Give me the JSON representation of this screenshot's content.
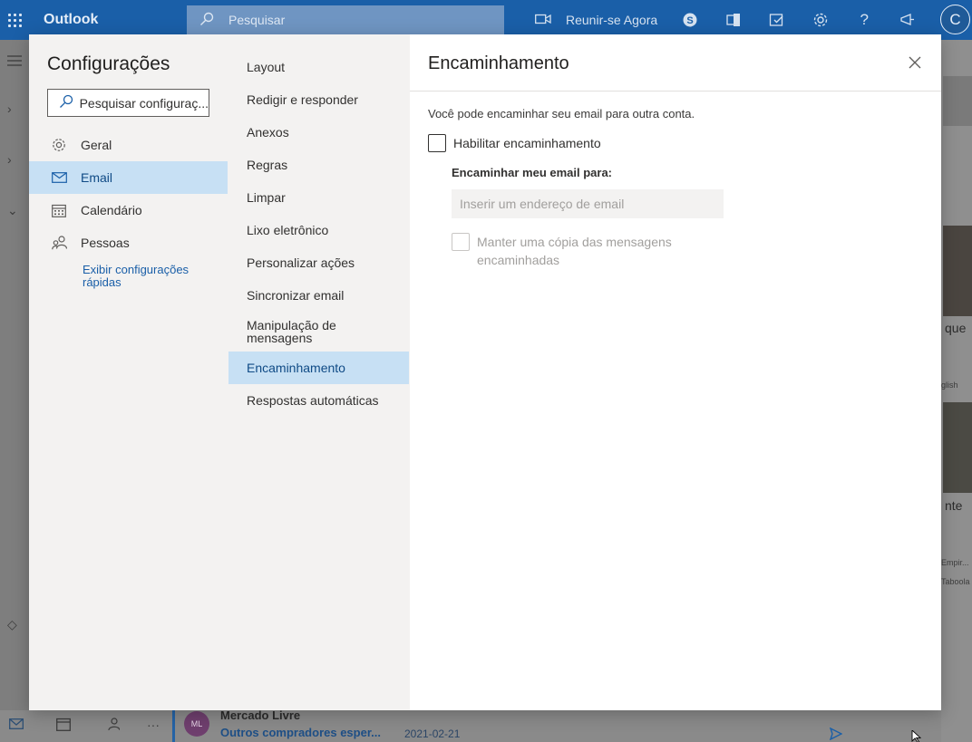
{
  "app": {
    "name": "Outlook"
  },
  "topbar": {
    "search_placeholder": "Pesquisar",
    "meet_now_label": "Reunir-se Agora",
    "avatar_initial": "C"
  },
  "background": {
    "right_snippets": [
      "que",
      "glish",
      "nte",
      "Empir...",
      "Taboola"
    ],
    "mail_preview": {
      "initials": "ML",
      "sender": "Mercado Livre",
      "subject": "Outros compradores esper...",
      "date": "2021-02-21"
    }
  },
  "dialog": {
    "title": "Configurações",
    "search_placeholder": "Pesquisar configuraç...",
    "categories": [
      {
        "label": "Geral",
        "icon": "gear-icon",
        "selected": false
      },
      {
        "label": "Email",
        "icon": "mail-icon",
        "selected": true
      },
      {
        "label": "Calendário",
        "icon": "calendar-icon",
        "selected": false
      },
      {
        "label": "Pessoas",
        "icon": "people-icon",
        "selected": false
      }
    ],
    "quick_settings_link": "Exibir configurações rápidas",
    "subcategories": [
      {
        "label": "Layout",
        "selected": false
      },
      {
        "label": "Redigir e responder",
        "selected": false
      },
      {
        "label": "Anexos",
        "selected": false
      },
      {
        "label": "Regras",
        "selected": false
      },
      {
        "label": "Limpar",
        "selected": false
      },
      {
        "label": "Lixo eletrônico",
        "selected": false
      },
      {
        "label": "Personalizar ações",
        "selected": false
      },
      {
        "label": "Sincronizar email",
        "selected": false
      },
      {
        "label": "Manipulação de mensagens",
        "selected": false
      },
      {
        "label": "Encaminhamento",
        "selected": true
      },
      {
        "label": "Respostas automáticas",
        "selected": false
      }
    ],
    "pane": {
      "title": "Encaminhamento",
      "description": "Você pode encaminhar seu email para outra conta.",
      "enable_forwarding": {
        "label": "Habilitar encaminhamento",
        "checked": false
      },
      "forward_to_label": "Encaminhar meu email para:",
      "forward_to_placeholder": "Inserir um endereço de email",
      "forward_to_value": "",
      "keep_copy": {
        "label": "Manter uma cópia das mensagens encaminhadas",
        "checked": false,
        "disabled": true
      }
    }
  },
  "colors": {
    "brand_bar": "#1a5fa8",
    "selection": "#c7e0f4",
    "link": "#1a5fa8",
    "nav_background": "#f3f2f1"
  }
}
